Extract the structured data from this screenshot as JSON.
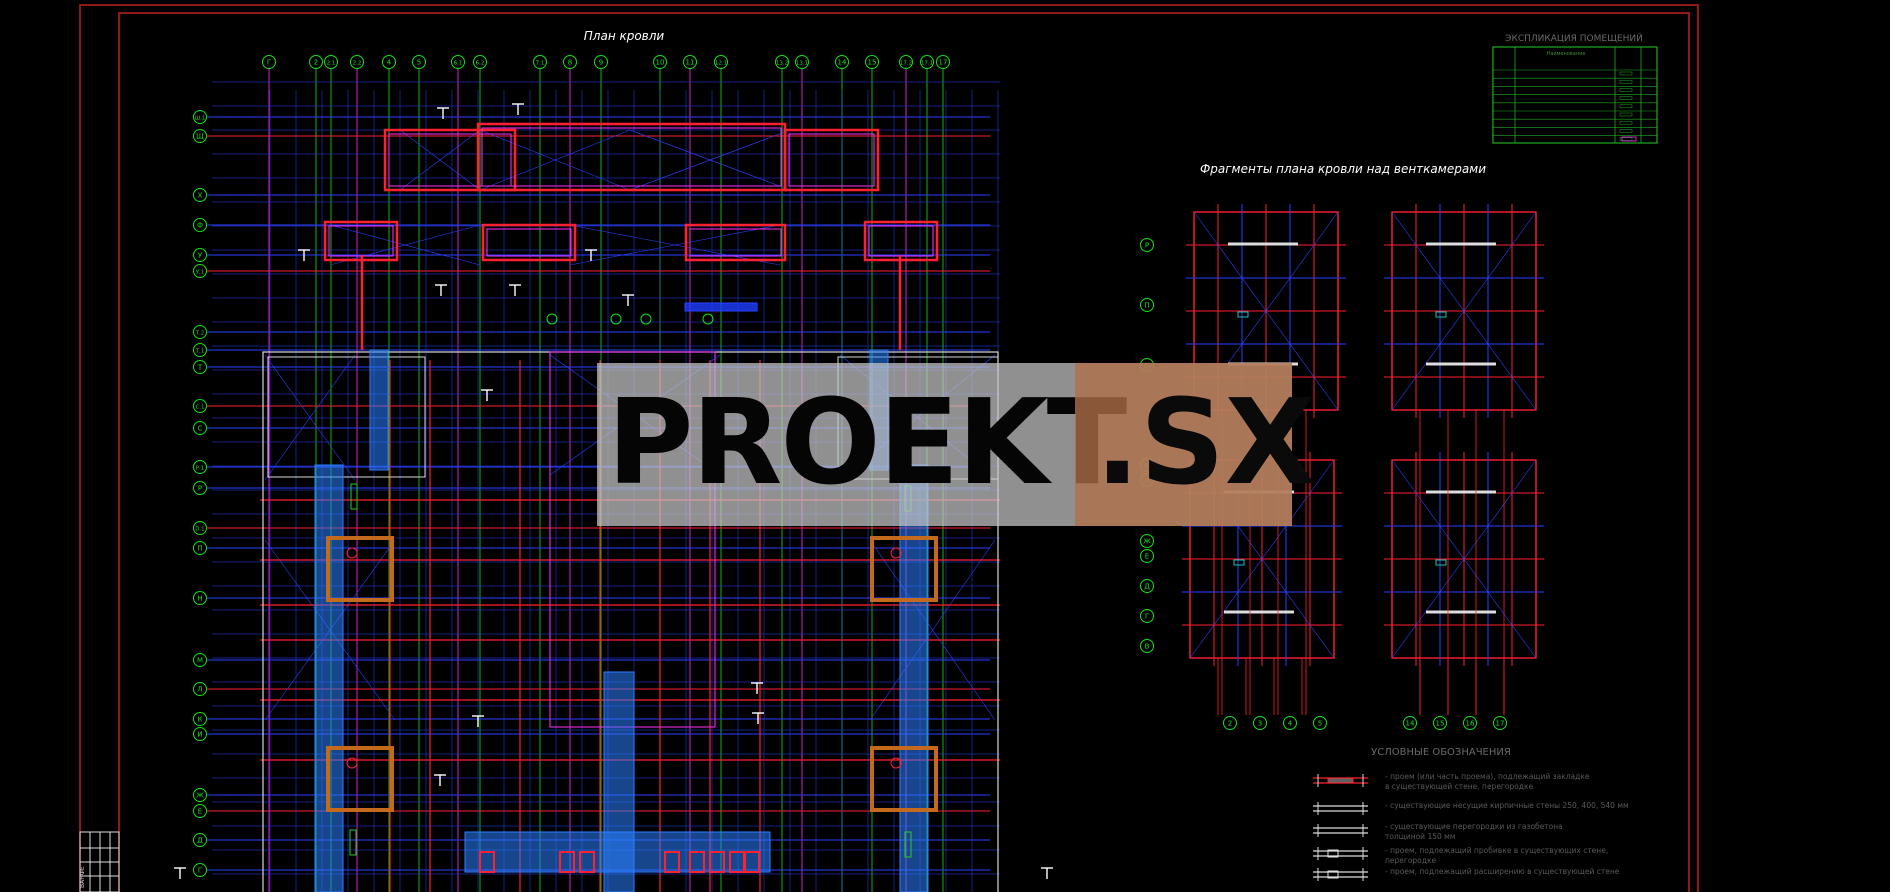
{
  "drawing": {
    "plan_title": "План кровли",
    "fragments_title": "Фрагменты плана кровли над венткамерами",
    "legend_title": "УСЛОВНЫЕ ОБОЗНАЧЕНИЯ",
    "explication_title": "ЭКСПЛИКАЦИЯ ПОМЕЩЕНИЙ",
    "explication_header": "Наименование",
    "legend_items": [
      "- проем (или часть проема), подлежащий закладке",
      "  в существующей стене, перегородке",
      "- существующие несущие кирпичные стены 250, 400, 540 мм",
      "- существующие перегородки из газобетона",
      "  толщиной 150 мм",
      "- проем, подлежащий пробивке в существующих стене,",
      "  перегородке",
      "- проем, подлежащий расширению в существующей стене"
    ],
    "main_top_axes": [
      "Г",
      "2",
      "2.1",
      "2.2",
      "4",
      "5",
      "6.1",
      "6.2",
      "7.1",
      "8",
      "9",
      "10",
      "11",
      "12.1",
      "13.2",
      "13.1",
      "14",
      "15",
      "17.2",
      "17.1",
      "17"
    ],
    "main_left_axes": [
      "Ш.1",
      "Щ",
      "Х",
      "Ф",
      "У",
      "У.1",
      "Т.2",
      "Т.1",
      "Т",
      "С.1",
      "С",
      "Р.1",
      "Р",
      "П.1",
      "П",
      "Н",
      "М",
      "Л",
      "К",
      "И",
      "Ж",
      "Е",
      "Д",
      "Г"
    ],
    "frag_left_axes": [
      "Р",
      "П",
      "Н",
      "К",
      "И",
      "Ж",
      "Е",
      "Д",
      "Г",
      "В"
    ],
    "frag_bottom_axes_a": [
      "2",
      "3",
      "4",
      "5"
    ],
    "frag_bottom_axes_b": [
      "14",
      "15",
      "16",
      "17"
    ],
    "stamp_letters": "ВАНФЕ"
  },
  "watermark": {
    "left": "PROEKT",
    "right": ".SX"
  },
  "colors": {
    "frame": "#e02020",
    "axis": "#18e018",
    "grid": "#2a40ff",
    "wall": "#ff2030",
    "parapet": "#ff30ff",
    "shaft": "#2b7fff",
    "vent": "#c46a1c"
  }
}
